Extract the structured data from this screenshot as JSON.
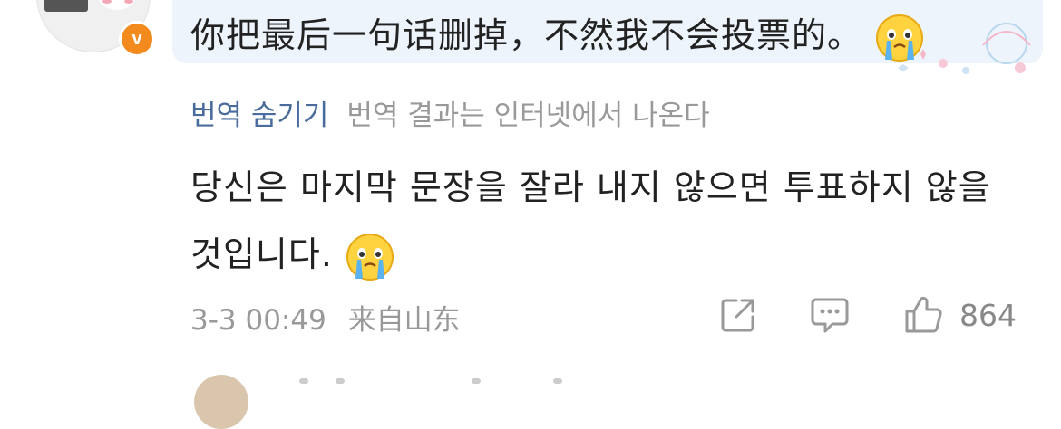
{
  "comment": {
    "text": "你把最后一句话删掉，不然我不会投票的。",
    "emoji": "crying-face-emoji",
    "verified_badge": "v"
  },
  "translation": {
    "hide_label": "번역 숨기기",
    "source_note": "번역 결과는 인터넷에서 나온다",
    "text": "당신은 마지막 문장을 잘라 내지 않으면 투표하지 않을 것입니다."
  },
  "meta": {
    "time": "3-3 00:49",
    "location": "来自山东"
  },
  "actions": {
    "like_count": "864"
  },
  "colors": {
    "link": "#4a6c9c",
    "muted": "#999999",
    "badge": "#f28a1e",
    "bubble": "#eef4fb"
  }
}
